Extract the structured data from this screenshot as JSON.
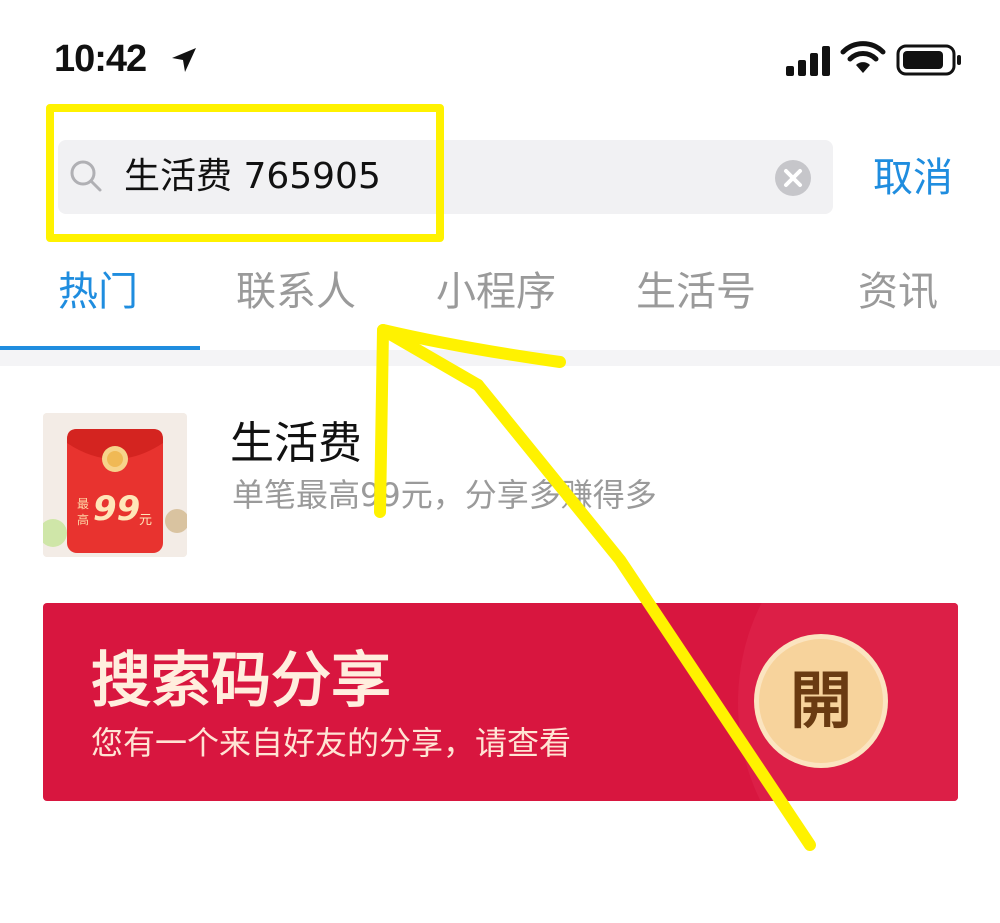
{
  "status_bar": {
    "time": "10:42",
    "icons": [
      "location-arrow-icon",
      "signal-icon",
      "wifi-icon",
      "battery-icon"
    ]
  },
  "search": {
    "query": "生活费 765905",
    "cancel_label": "取消",
    "icons": [
      "search-icon",
      "clear-icon"
    ]
  },
  "tabs": [
    {
      "label": "热门",
      "active": true
    },
    {
      "label": "联系人",
      "active": false
    },
    {
      "label": "小程序",
      "active": false
    },
    {
      "label": "生活号",
      "active": false
    },
    {
      "label": "资讯",
      "active": false
    }
  ],
  "result": {
    "title": "生活费",
    "subtitle": "单笔最高99元，分享多赚得多",
    "thumb_text": "99",
    "thumb_small_top": "最",
    "thumb_small_bottom": "高",
    "thumb_unit": "元"
  },
  "banner": {
    "title": "搜索码分享",
    "subtitle": "您有一个来自好友的分享，请查看",
    "button_label": "開"
  },
  "colors": {
    "accent": "#1f8ddf",
    "banner_red": "#d8163f",
    "highlight_yellow": "#fff200"
  }
}
